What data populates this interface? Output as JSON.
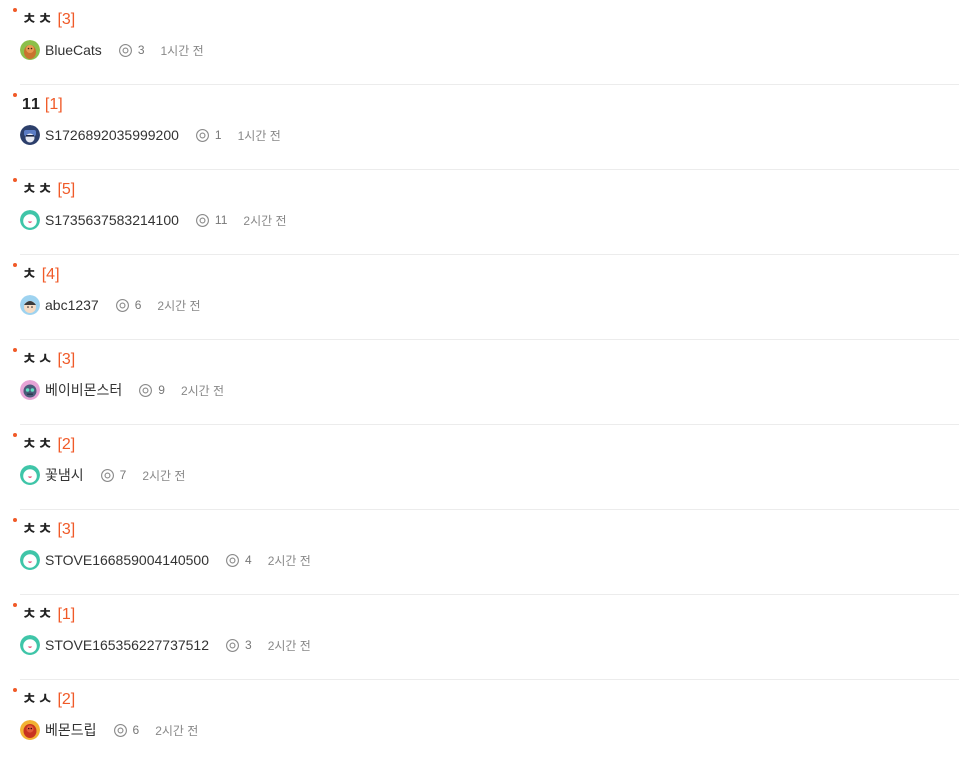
{
  "colors": {
    "accent": "#f05a28",
    "title": "#222222",
    "meta": "#777777",
    "divider": "#ececec"
  },
  "posts": [
    {
      "title": "ㅊㅊ",
      "comments": "[3]",
      "author": "BlueCats",
      "views": "3",
      "time": "1시간 전",
      "avatar": "orange-creature-avatar"
    },
    {
      "title": "11",
      "comments": "[1]",
      "author": "S1726892035999200",
      "views": "1",
      "time": "1시간 전",
      "avatar": "blue-helmet-avatar"
    },
    {
      "title": "ㅊㅊ",
      "comments": "[5]",
      "author": "S1735637583214100",
      "views": "11",
      "time": "2시간 전",
      "avatar": "mint-default-avatar"
    },
    {
      "title": "ㅊ",
      "comments": "[4]",
      "author": "abc1237",
      "views": "6",
      "time": "2시간 전",
      "avatar": "character-face-avatar"
    },
    {
      "title": "ㅊㅅ",
      "comments": "[3]",
      "author": "베이비몬스터",
      "views": "9",
      "time": "2시간 전",
      "avatar": "purple-robot-avatar"
    },
    {
      "title": "ㅊㅊ",
      "comments": "[2]",
      "author": "꽃냄시",
      "views": "7",
      "time": "2시간 전",
      "avatar": "mint-default-avatar"
    },
    {
      "title": "ㅊㅊ",
      "comments": "[3]",
      "author": "STOVE166859004140500",
      "views": "4",
      "time": "2시간 전",
      "avatar": "mint-default-avatar"
    },
    {
      "title": "ㅊㅊ",
      "comments": "[1]",
      "author": "STOVE165356227737512",
      "views": "3",
      "time": "2시간 전",
      "avatar": "mint-default-avatar"
    },
    {
      "title": "ㅊㅅ",
      "comments": "[2]",
      "author": "베몬드립",
      "views": "6",
      "time": "2시간 전",
      "avatar": "red-creature-avatar"
    }
  ]
}
